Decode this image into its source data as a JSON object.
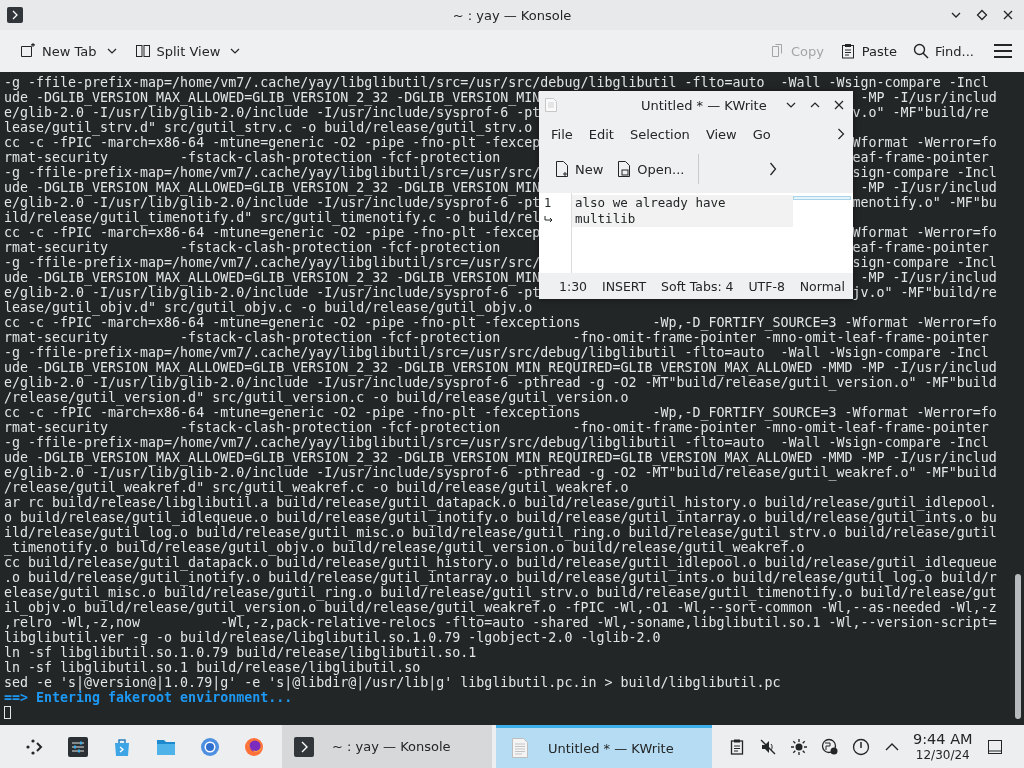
{
  "konsole": {
    "title": "~ : yay — Konsole",
    "toolbar_left": [
      {
        "label": "New Tab",
        "menu": true,
        "disabled": false
      },
      {
        "label": "Split View",
        "menu": true,
        "disabled": false
      }
    ],
    "toolbar_right": [
      {
        "label": "Copy",
        "menu": false,
        "disabled": true
      },
      {
        "label": "Paste",
        "menu": false,
        "disabled": false
      },
      {
        "label": "Find...",
        "menu": false,
        "disabled": false
      }
    ],
    "terminal": {
      "lines": [
        {
          "kind": "output",
          "text": "-g -ffile-prefix-map=/home/vm7/.cache/yay/libglibutil/src=/usr/src/debug/libglibutil -flto=auto  -Wall -Wsign-compare -Incl"
        },
        {
          "kind": "split",
          "left": "ude -DGLIB_VERSION_MAX_ALLOWED=GLIB_VERSION_2_32 -DGLIB_VERSION_MIN",
          "right": " -MP -I/usr/includ"
        },
        {
          "kind": "split",
          "left": "e/glib-2.0 -I/usr/lib/glib-2.0/include -I/usr/include/sysprof-6 -pt",
          "right": "v.o\" -MF\"build/re"
        },
        {
          "kind": "output",
          "text": "lease/gutil_strv.d\" src/gutil_strv.c -o build/release/gutil_strv.o"
        },
        {
          "kind": "split",
          "left": "cc -c -fPIC -march=x86-64 -mtune=generic -O2 -pipe -fno-plt -fexcep",
          "right": "Wformat -Werror=fo"
        },
        {
          "kind": "split",
          "left": "rmat-security         -fstack-clash-protection -fcf-protection",
          "right": "eaf-frame-pointer"
        },
        {
          "kind": "split",
          "left": "-g -ffile-prefix-map=/home/vm7/.cache/yay/libglibutil/src=/usr/src/",
          "right": "sign-compare -Incl"
        },
        {
          "kind": "split",
          "left": "ude -DGLIB_VERSION_MAX_ALLOWED=GLIB_VERSION_2_32 -DGLIB_VERSION_MIN",
          "right": " -MP -I/usr/includ"
        },
        {
          "kind": "split",
          "left": "e/glib-2.0 -I/usr/lib/glib-2.0/include -I/usr/include/sysprof-6 -pt",
          "right": "menotify.o\" -MF\"bu"
        },
        {
          "kind": "output",
          "text": "ild/release/gutil_timenotify.d\" src/gutil_timenotify.c -o build/rel"
        },
        {
          "kind": "split",
          "left": "cc -c -fPIC -march=x86-64 -mtune=generic -O2 -pipe -fno-plt -fexcep",
          "right": "Wformat -Werror=fo"
        },
        {
          "kind": "split",
          "left": "rmat-security         -fstack-clash-protection -fcf-protection",
          "right": "eaf-frame-pointer"
        },
        {
          "kind": "split",
          "left": "-g -ffile-prefix-map=/home/vm7/.cache/yay/libglibutil/src=/usr/src/",
          "right": "sign-compare -Incl"
        },
        {
          "kind": "split",
          "left": "ude -DGLIB_VERSION_MAX_ALLOWED=GLIB_VERSION_2_32 -DGLIB_VERSION_MIN",
          "right": " -MP -I/usr/includ"
        },
        {
          "kind": "split",
          "left": "e/glib-2.0 -I/usr/lib/glib-2.0/include -I/usr/include/sysprof-6 -pt",
          "right": "jv.o\" -MF\"build/re"
        },
        {
          "kind": "output",
          "text": "lease/gutil_objv.d\" src/gutil_objv.c -o build/release/gutil_objv.o"
        },
        {
          "kind": "output",
          "text": "cc -c -fPIC -march=x86-64 -mtune=generic -O2 -pipe -fno-plt -fexceptions         -Wp,-D_FORTIFY_SOURCE=3 -Wformat -Werror=fo"
        },
        {
          "kind": "output",
          "text": "rmat-security         -fstack-clash-protection -fcf-protection         -fno-omit-frame-pointer -mno-omit-leaf-frame-pointer"
        },
        {
          "kind": "output",
          "text": "-g -ffile-prefix-map=/home/vm7/.cache/yay/libglibutil/src=/usr/src/debug/libglibutil -flto=auto  -Wall -Wsign-compare -Incl"
        },
        {
          "kind": "output",
          "text": "ude -DGLIB_VERSION_MAX_ALLOWED=GLIB_VERSION_2_32 -DGLIB_VERSION_MIN_REQUIRED=GLIB_VERSION_MAX_ALLOWED -MMD -MP -I/usr/includ"
        },
        {
          "kind": "output",
          "text": "e/glib-2.0 -I/usr/lib/glib-2.0/include -I/usr/include/sysprof-6 -pthread -g -O2 -MT\"build/release/gutil_version.o\" -MF\"build"
        },
        {
          "kind": "output",
          "text": "/release/gutil_version.d\" src/gutil_version.c -o build/release/gutil_version.o"
        },
        {
          "kind": "output",
          "text": "cc -c -fPIC -march=x86-64 -mtune=generic -O2 -pipe -fno-plt -fexceptions         -Wp,-D_FORTIFY_SOURCE=3 -Wformat -Werror=fo"
        },
        {
          "kind": "output",
          "text": "rmat-security         -fstack-clash-protection -fcf-protection         -fno-omit-frame-pointer -mno-omit-leaf-frame-pointer"
        },
        {
          "kind": "output",
          "text": "-g -ffile-prefix-map=/home/vm7/.cache/yay/libglibutil/src=/usr/src/debug/libglibutil -flto=auto  -Wall -Wsign-compare -Incl"
        },
        {
          "kind": "output",
          "text": "ude -DGLIB_VERSION_MAX_ALLOWED=GLIB_VERSION_2_32 -DGLIB_VERSION_MIN_REQUIRED=GLIB_VERSION_MAX_ALLOWED -MMD -MP -I/usr/includ"
        },
        {
          "kind": "output",
          "text": "e/glib-2.0 -I/usr/lib/glib-2.0/include -I/usr/include/sysprof-6 -pthread -g -O2 -MT\"build/release/gutil_weakref.o\" -MF\"build"
        },
        {
          "kind": "output",
          "text": "/release/gutil_weakref.d\" src/gutil_weakref.c -o build/release/gutil_weakref.o"
        },
        {
          "kind": "output",
          "text": "ar rc build/release/libglibutil.a build/release/gutil_datapack.o build/release/gutil_history.o build/release/gutil_idlepool."
        },
        {
          "kind": "output",
          "text": "o build/release/gutil_idlequeue.o build/release/gutil_inotify.o build/release/gutil_intarray.o build/release/gutil_ints.o bu"
        },
        {
          "kind": "output",
          "text": "ild/release/gutil_log.o build/release/gutil_misc.o build/release/gutil_ring.o build/release/gutil_strv.o build/release/gutil"
        },
        {
          "kind": "output",
          "text": "_timenotify.o build/release/gutil_objv.o build/release/gutil_version.o build/release/gutil_weakref.o"
        },
        {
          "kind": "output",
          "text": "cc build/release/gutil_datapack.o build/release/gutil_history.o build/release/gutil_idlepool.o build/release/gutil_idlequeue"
        },
        {
          "kind": "output",
          "text": ".o build/release/gutil_inotify.o build/release/gutil_intarray.o build/release/gutil_ints.o build/release/gutil_log.o build/r"
        },
        {
          "kind": "output",
          "text": "elease/gutil_misc.o build/release/gutil_ring.o build/release/gutil_strv.o build/release/gutil_timenotify.o build/release/gut"
        },
        {
          "kind": "output",
          "text": "il_objv.o build/release/gutil_version.o build/release/gutil_weakref.o -fPIC -Wl,-O1 -Wl,--sort-common -Wl,--as-needed -Wl,-z"
        },
        {
          "kind": "output",
          "text": ",relro -Wl,-z,now          -Wl,-z,pack-relative-relocs -flto=auto -shared -Wl,-soname,libglibutil.so.1 -Wl,--version-script="
        },
        {
          "kind": "output",
          "text": "libglibutil.ver -g -o build/release/libglibutil.so.1.0.79 -lgobject-2.0 -lglib-2.0"
        },
        {
          "kind": "output",
          "text": "ln -sf libglibutil.so.1.0.79 build/release/libglibutil.so.1"
        },
        {
          "kind": "output",
          "text": "ln -sf libglibutil.so.1 build/release/libglibutil.so"
        },
        {
          "kind": "output",
          "text": "sed -e 's|@version@|1.0.79|g' -e 's|@libdir@|/usr/lib|g' libglibutil.pc.in > build/libglibutil.pc"
        },
        {
          "kind": "notice",
          "text": "==> Entering fakeroot environment..."
        },
        {
          "kind": "cursor"
        }
      ]
    }
  },
  "kwrite": {
    "title": "Untitled * — KWrite",
    "menus": [
      "File",
      "Edit",
      "Selection",
      "View",
      "Go"
    ],
    "toolbar": [
      "New",
      "Open..."
    ],
    "editor": {
      "line_number": "1",
      "rows": [
        "also we already have",
        "multilib"
      ]
    },
    "status": [
      "1:30",
      "INSERT",
      "Soft Tabs: 4",
      "UTF-8",
      "Normal"
    ]
  },
  "taskbar": {
    "tasks": [
      {
        "label": "~ : yay — Konsole",
        "selected": false
      },
      {
        "label": "Untitled * — KWrite",
        "selected": true
      }
    ],
    "clock": {
      "time": "9:44 AM",
      "date": "12/30/24"
    }
  }
}
